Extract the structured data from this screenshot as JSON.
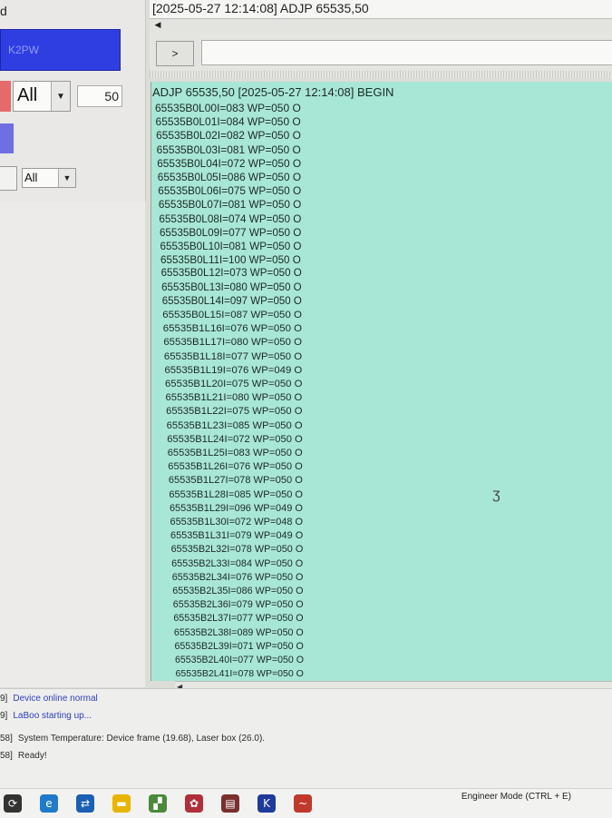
{
  "header": {
    "title": "[2025-05-27 12:14:08]   ADJP 65535,50"
  },
  "toolbar": {
    "run_label": ">",
    "command_value": ""
  },
  "left_panel": {
    "corner_glyph": "d",
    "blue_button_label": "K2PW",
    "mode_select_value": "All",
    "count_value": "50",
    "filter_select_value": "All"
  },
  "log": {
    "header": "ADJP 65535,50 [2025-05-27 12:14:08]   BEGIN",
    "lines": [
      "65535B0L00I=083 WP=050 O",
      "65535B0L01I=084 WP=050 O",
      "65535B0L02I=082 WP=050 O",
      "65535B0L03I=081 WP=050 O",
      "65535B0L04I=072 WP=050 O",
      "65535B0L05I=086 WP=050 O",
      "65535B0L06I=075 WP=050 O",
      "65535B0L07I=081 WP=050 O",
      "65535B0L08I=074 WP=050 O",
      "65535B0L09I=077 WP=050 O",
      "65535B0L10I=081 WP=050 O",
      "65535B0L11I=100 WP=050 O",
      "65535B0L12I=073 WP=050 O",
      "65535B0L13I=080 WP=050 O",
      "65535B0L14I=097 WP=050 O",
      "65535B0L15I=087 WP=050 O",
      "65535B1L16I=076 WP=050 O",
      "65535B1L17I=080 WP=050 O",
      "65535B1L18I=077 WP=050 O",
      "65535B1L19I=076 WP=049 O",
      "65535B1L20I=075 WP=050 O",
      "65535B1L21I=080 WP=050 O",
      "65535B1L22I=075 WP=050 O",
      "65535B1L23I=085 WP=050 O",
      "65535B1L24I=072 WP=050 O",
      "65535B1L25I=083 WP=050 O",
      "65535B1L26I=076 WP=050 O",
      "65535B1L27I=078 WP=050 O",
      "65535B1L28I=085 WP=050 O",
      "65535B1L29I=096 WP=049 O",
      "65535B1L30I=072 WP=048 O",
      "65535B1L31I=079 WP=049 O",
      "65535B2L32I=078 WP=050 O",
      "65535B2L33I=084 WP=050 O",
      "65535B2L34I=076 WP=050 O",
      "65535B2L35I=086 WP=050 O",
      "65535B2L36I=079 WP=050 O",
      "65535B2L37I=077 WP=050 O",
      "65535B2L38I=089 WP=050 O",
      "65535B2L39I=071 WP=050 O",
      "65535B2L40I=077 WP=050 O",
      "65535B2L41I=078 WP=050 O"
    ]
  },
  "status": [
    {
      "prefix": "9]",
      "message": "Device online normal"
    },
    {
      "prefix": "9]",
      "message": "LaBoo starting up..."
    },
    {
      "prefix": "58]",
      "message": "System Temperature: Device frame (19.68), Laser box (26.0)."
    },
    {
      "prefix": "58]",
      "message": "Ready!"
    }
  ],
  "taskbar": {
    "engineer_mode": "Engineer Mode (CTRL + E)",
    "icons": [
      "app-icon",
      "edge-icon",
      "teamviewer-icon",
      "folder-icon",
      "tool-icon",
      "network-icon",
      "board-icon",
      "k-icon",
      "ckow-icon"
    ],
    "icon_colors": [
      "#333333",
      "#1f7ac9",
      "#1a5fb4",
      "#e8b400",
      "#4a8a3a",
      "#b0303a",
      "#7a2f2f",
      "#1e3a9a",
      "#c0392b"
    ]
  }
}
